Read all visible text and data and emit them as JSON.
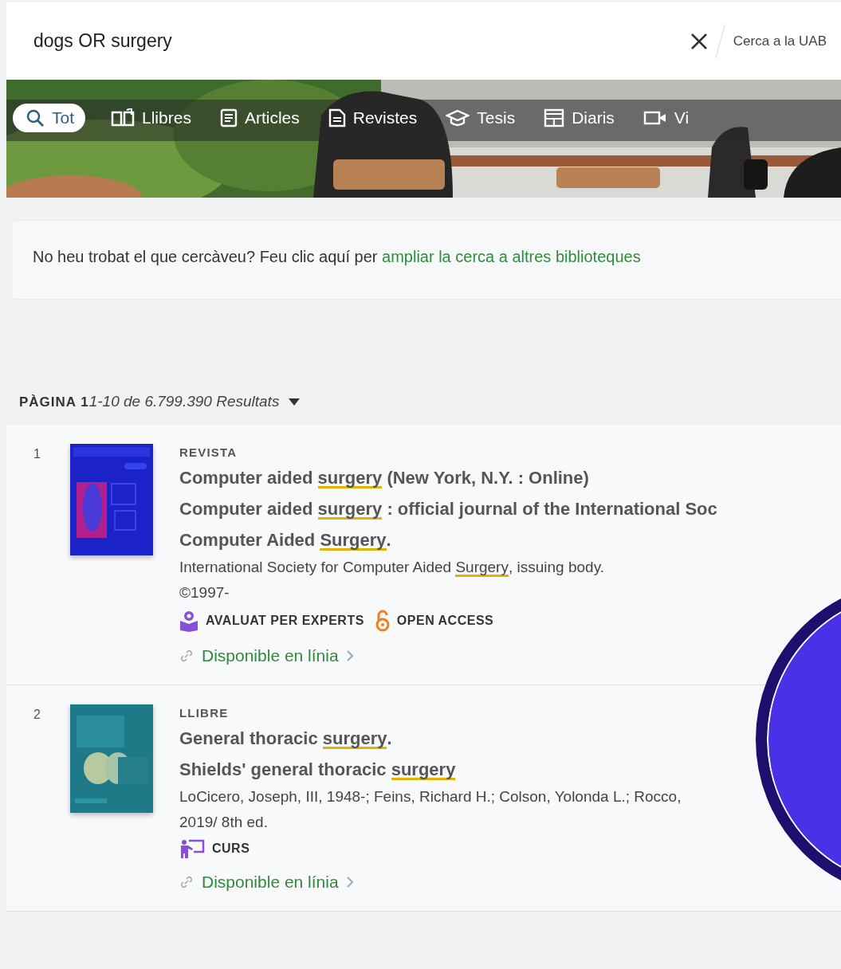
{
  "search": {
    "value": "dogs OR surgery",
    "scope": "Cerca a la UAB"
  },
  "tabs": [
    {
      "label": "Tot",
      "selected": true
    },
    {
      "label": "Llibres",
      "selected": false
    },
    {
      "label": "Articles",
      "selected": false
    },
    {
      "label": "Revistes",
      "selected": false
    },
    {
      "label": "Tesis",
      "selected": false
    },
    {
      "label": "Diaris",
      "selected": false
    },
    {
      "label": "Vi",
      "selected": false
    }
  ],
  "notice": {
    "text": "No heu trobat el que cercàveu? Feu clic aquí per",
    "link": "ampliar la cerca a altres biblioteques"
  },
  "results_count": {
    "page": "PÀGINA 1",
    "range": "1-10 de 6.799.390 Resultats"
  },
  "results": [
    {
      "number": "1",
      "type": "REVISTA",
      "cover": {
        "kind": "picture"
      },
      "title_lines": [
        [
          {
            "text": "Computer aided ",
            "highlight": false
          },
          {
            "text": "surgery",
            "highlight": true
          },
          {
            "text": " (New York, N.Y. : Online)",
            "highlight": false
          }
        ],
        [
          {
            "text": "Computer aided ",
            "highlight": false
          },
          {
            "text": "surgery",
            "highlight": true
          },
          {
            "text": " : official journal of the International Soc",
            "highlight": false
          }
        ],
        [
          {
            "text": "Computer Aided ",
            "highlight": false
          },
          {
            "text": "Surgery",
            "highlight": true
          },
          {
            "text": ".",
            "highlight": false
          }
        ]
      ],
      "author": [
        {
          "text": "International Society for Computer Aided ",
          "highlight": false
        },
        {
          "text": "Surgery",
          "highlight": true
        },
        {
          "text": ", issuing body.",
          "highlight": false
        }
      ],
      "date": "©1997-",
      "badges": [
        {
          "kind": "peer_reviewed",
          "label": "AVALUAT PER EXPERTS"
        },
        {
          "kind": "open_access",
          "label": "OPEN ACCESS"
        }
      ],
      "availability": "Disponible en línia"
    },
    {
      "number": "2",
      "type": "LLIBRE",
      "cover": {
        "kind": "picture"
      },
      "title_lines": [
        [
          {
            "text": "General thoracic ",
            "highlight": false
          },
          {
            "text": "surgery",
            "highlight": true
          },
          {
            "text": ".",
            "highlight": false
          }
        ],
        [
          {
            "text": "Shields' general thoracic ",
            "highlight": false
          },
          {
            "text": "surgery",
            "highlight": true
          }
        ]
      ],
      "author": [
        {
          "text": "LoCicero, Joseph, III, 1948-; Feins, Richard H.; Colson, Yolonda L.; Rocco,",
          "highlight": false
        }
      ],
      "date": "2019/ 8th ed.",
      "badges": [
        {
          "kind": "course",
          "label": "CURS"
        }
      ],
      "availability": "Disponible en línia"
    }
  ]
}
